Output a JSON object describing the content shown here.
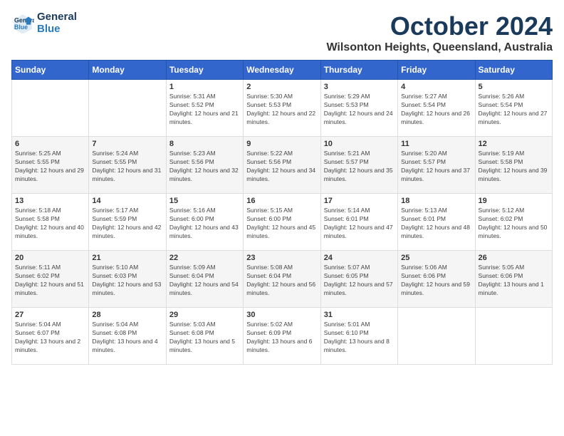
{
  "header": {
    "logo_line1": "General",
    "logo_line2": "Blue",
    "month_year": "October 2024",
    "location": "Wilsonton Heights, Queensland, Australia"
  },
  "weekdays": [
    "Sunday",
    "Monday",
    "Tuesday",
    "Wednesday",
    "Thursday",
    "Friday",
    "Saturday"
  ],
  "weeks": [
    [
      {
        "day": "",
        "info": ""
      },
      {
        "day": "",
        "info": ""
      },
      {
        "day": "1",
        "info": "Sunrise: 5:31 AM\nSunset: 5:52 PM\nDaylight: 12 hours and 21 minutes."
      },
      {
        "day": "2",
        "info": "Sunrise: 5:30 AM\nSunset: 5:53 PM\nDaylight: 12 hours and 22 minutes."
      },
      {
        "day": "3",
        "info": "Sunrise: 5:29 AM\nSunset: 5:53 PM\nDaylight: 12 hours and 24 minutes."
      },
      {
        "day": "4",
        "info": "Sunrise: 5:27 AM\nSunset: 5:54 PM\nDaylight: 12 hours and 26 minutes."
      },
      {
        "day": "5",
        "info": "Sunrise: 5:26 AM\nSunset: 5:54 PM\nDaylight: 12 hours and 27 minutes."
      }
    ],
    [
      {
        "day": "6",
        "info": "Sunrise: 5:25 AM\nSunset: 5:55 PM\nDaylight: 12 hours and 29 minutes."
      },
      {
        "day": "7",
        "info": "Sunrise: 5:24 AM\nSunset: 5:55 PM\nDaylight: 12 hours and 31 minutes."
      },
      {
        "day": "8",
        "info": "Sunrise: 5:23 AM\nSunset: 5:56 PM\nDaylight: 12 hours and 32 minutes."
      },
      {
        "day": "9",
        "info": "Sunrise: 5:22 AM\nSunset: 5:56 PM\nDaylight: 12 hours and 34 minutes."
      },
      {
        "day": "10",
        "info": "Sunrise: 5:21 AM\nSunset: 5:57 PM\nDaylight: 12 hours and 35 minutes."
      },
      {
        "day": "11",
        "info": "Sunrise: 5:20 AM\nSunset: 5:57 PM\nDaylight: 12 hours and 37 minutes."
      },
      {
        "day": "12",
        "info": "Sunrise: 5:19 AM\nSunset: 5:58 PM\nDaylight: 12 hours and 39 minutes."
      }
    ],
    [
      {
        "day": "13",
        "info": "Sunrise: 5:18 AM\nSunset: 5:58 PM\nDaylight: 12 hours and 40 minutes."
      },
      {
        "day": "14",
        "info": "Sunrise: 5:17 AM\nSunset: 5:59 PM\nDaylight: 12 hours and 42 minutes."
      },
      {
        "day": "15",
        "info": "Sunrise: 5:16 AM\nSunset: 6:00 PM\nDaylight: 12 hours and 43 minutes."
      },
      {
        "day": "16",
        "info": "Sunrise: 5:15 AM\nSunset: 6:00 PM\nDaylight: 12 hours and 45 minutes."
      },
      {
        "day": "17",
        "info": "Sunrise: 5:14 AM\nSunset: 6:01 PM\nDaylight: 12 hours and 47 minutes."
      },
      {
        "day": "18",
        "info": "Sunrise: 5:13 AM\nSunset: 6:01 PM\nDaylight: 12 hours and 48 minutes."
      },
      {
        "day": "19",
        "info": "Sunrise: 5:12 AM\nSunset: 6:02 PM\nDaylight: 12 hours and 50 minutes."
      }
    ],
    [
      {
        "day": "20",
        "info": "Sunrise: 5:11 AM\nSunset: 6:02 PM\nDaylight: 12 hours and 51 minutes."
      },
      {
        "day": "21",
        "info": "Sunrise: 5:10 AM\nSunset: 6:03 PM\nDaylight: 12 hours and 53 minutes."
      },
      {
        "day": "22",
        "info": "Sunrise: 5:09 AM\nSunset: 6:04 PM\nDaylight: 12 hours and 54 minutes."
      },
      {
        "day": "23",
        "info": "Sunrise: 5:08 AM\nSunset: 6:04 PM\nDaylight: 12 hours and 56 minutes."
      },
      {
        "day": "24",
        "info": "Sunrise: 5:07 AM\nSunset: 6:05 PM\nDaylight: 12 hours and 57 minutes."
      },
      {
        "day": "25",
        "info": "Sunrise: 5:06 AM\nSunset: 6:06 PM\nDaylight: 12 hours and 59 minutes."
      },
      {
        "day": "26",
        "info": "Sunrise: 5:05 AM\nSunset: 6:06 PM\nDaylight: 13 hours and 1 minute."
      }
    ],
    [
      {
        "day": "27",
        "info": "Sunrise: 5:04 AM\nSunset: 6:07 PM\nDaylight: 13 hours and 2 minutes."
      },
      {
        "day": "28",
        "info": "Sunrise: 5:04 AM\nSunset: 6:08 PM\nDaylight: 13 hours and 4 minutes."
      },
      {
        "day": "29",
        "info": "Sunrise: 5:03 AM\nSunset: 6:08 PM\nDaylight: 13 hours and 5 minutes."
      },
      {
        "day": "30",
        "info": "Sunrise: 5:02 AM\nSunset: 6:09 PM\nDaylight: 13 hours and 6 minutes."
      },
      {
        "day": "31",
        "info": "Sunrise: 5:01 AM\nSunset: 6:10 PM\nDaylight: 13 hours and 8 minutes."
      },
      {
        "day": "",
        "info": ""
      },
      {
        "day": "",
        "info": ""
      }
    ]
  ]
}
